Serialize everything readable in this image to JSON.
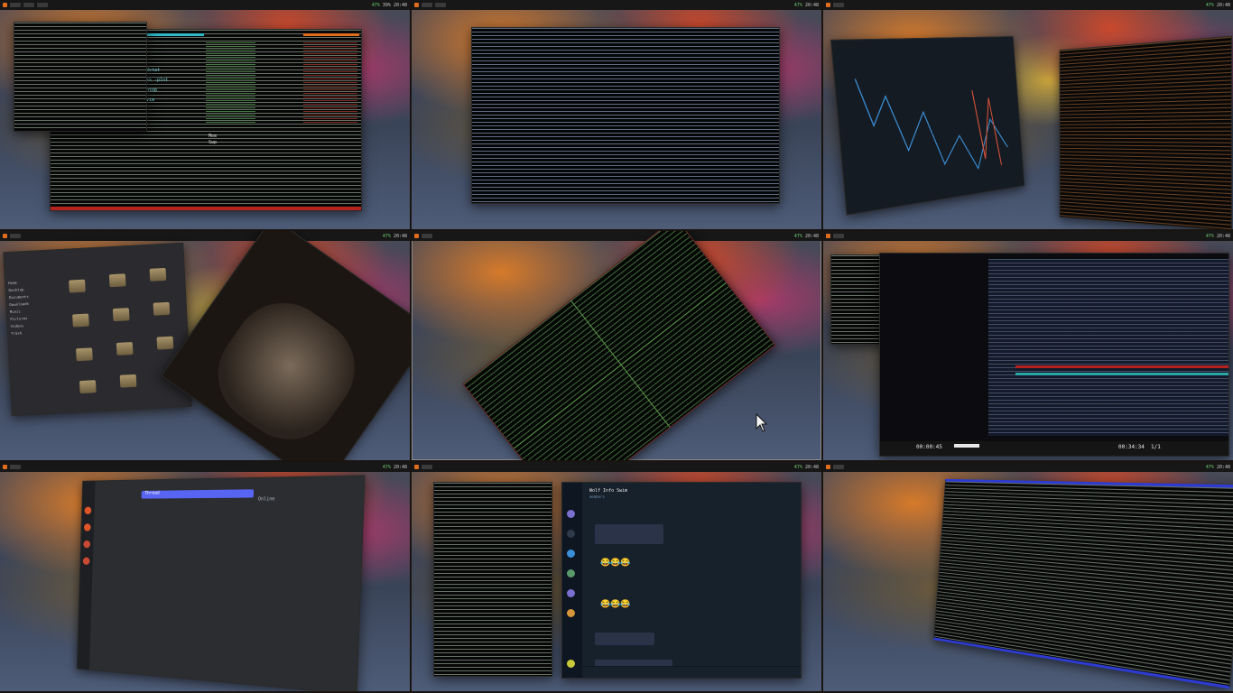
{
  "topbar": {
    "clock": "20:48",
    "status_ok": "47%",
    "battery": "39%"
  },
  "workspaces": [
    {
      "id": 1,
      "label": "Terminal (htop)"
    },
    {
      "id": 2,
      "label": "Terminal"
    },
    {
      "id": 3,
      "label": "Trading chart"
    },
    {
      "id": 4,
      "label": "File manager"
    },
    {
      "id": 5,
      "label": "Terminal grid"
    },
    {
      "id": 6,
      "label": "Video player"
    },
    {
      "id": 7,
      "label": "Discord"
    },
    {
      "id": 8,
      "label": "Telegram"
    },
    {
      "id": 9,
      "label": "Terminal"
    }
  ],
  "ws1": {
    "htop_items": [
      "dstat",
      "ss -plnt",
      "htop",
      "vim"
    ],
    "memory_label": "Mem",
    "swap_label": "Swp"
  },
  "ws4": {
    "sidebar_items": [
      "Home",
      "Desktop",
      "Documents",
      "Downloads",
      "Music",
      "Pictures",
      "Videos",
      "Trash"
    ]
  },
  "ws6": {
    "time_elapsed": "00:00:45",
    "time_total": "00:34:34",
    "playlist_pos": "1/1"
  },
  "ws7": {
    "tab_label": "Thread",
    "member_section": "Online"
  },
  "ws8": {
    "chat_title": "Wolf Info Swim",
    "subtitle": "members",
    "emoji_row1": "😂😂😂",
    "emoji_row2": "😂😂😂"
  },
  "colors": {
    "accent": "#e06c1e",
    "terminal_bg": "#070707",
    "statusbar_red": "#b5231f",
    "discord_bg": "#2b2d31",
    "telegram_bg": "#17212b"
  },
  "cursor": {
    "icon": "arrow-pointer-icon"
  }
}
